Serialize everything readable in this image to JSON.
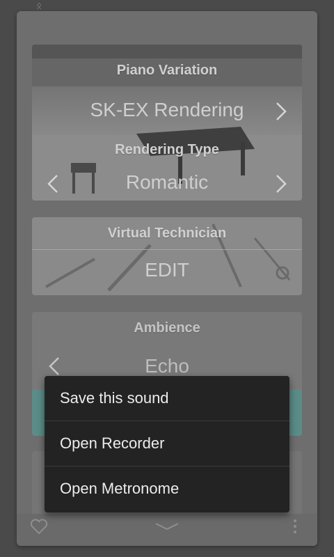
{
  "status": {
    "icon": "bluetooth-icon"
  },
  "piano_card": {
    "title": "Piano Variation",
    "value": "SK-EX Rendering",
    "rendering_title": "Rendering Type",
    "rendering_value": "Romantic"
  },
  "technician_card": {
    "title": "Virtual Technician",
    "value": "EDIT"
  },
  "ambience_card": {
    "title": "Ambience",
    "value": "Echo"
  },
  "bottom_bar": {
    "left_icon": "heart-icon",
    "center_icon": "chevron-down-icon",
    "right_icon": "more-vertical-icon"
  },
  "menu": {
    "items": [
      {
        "label": "Save this sound"
      },
      {
        "label": "Open Recorder"
      },
      {
        "label": "Open Metronome"
      }
    ]
  }
}
